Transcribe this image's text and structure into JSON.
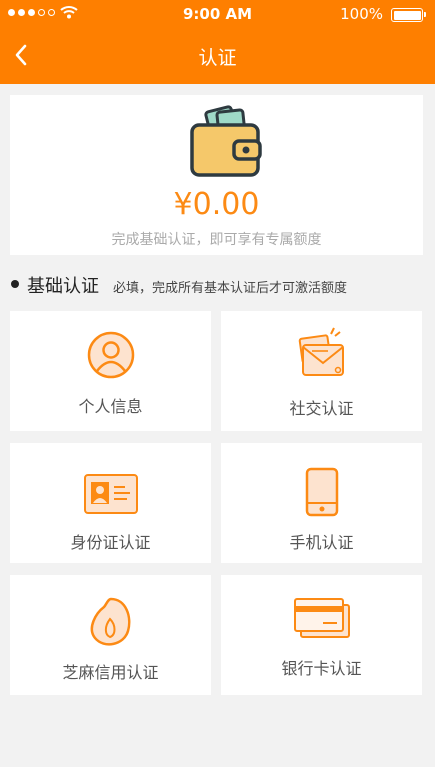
{
  "status_bar": {
    "time": "9:00 AM",
    "battery": "100%"
  },
  "nav": {
    "title": "认证"
  },
  "balance": {
    "amount": "¥0.00",
    "hint": "完成基础认证，即可享有专属额度"
  },
  "section": {
    "title": "基础认证",
    "note": "必填，完成所有基本认证后才可激活额度"
  },
  "tiles": [
    {
      "label": "个人信息",
      "icon": "person-icon"
    },
    {
      "label": "社交认证",
      "icon": "social-envelope-icon"
    },
    {
      "label": "身份证认证",
      "icon": "id-card-icon"
    },
    {
      "label": "手机认证",
      "icon": "phone-icon"
    },
    {
      "label": "芝麻信用认证",
      "icon": "sesame-icon"
    },
    {
      "label": "银行卡认证",
      "icon": "bank-card-icon"
    }
  ],
  "colors": {
    "accent": "#fe7f00",
    "icon": "#fc8a14",
    "background": "#f2f2f2"
  }
}
